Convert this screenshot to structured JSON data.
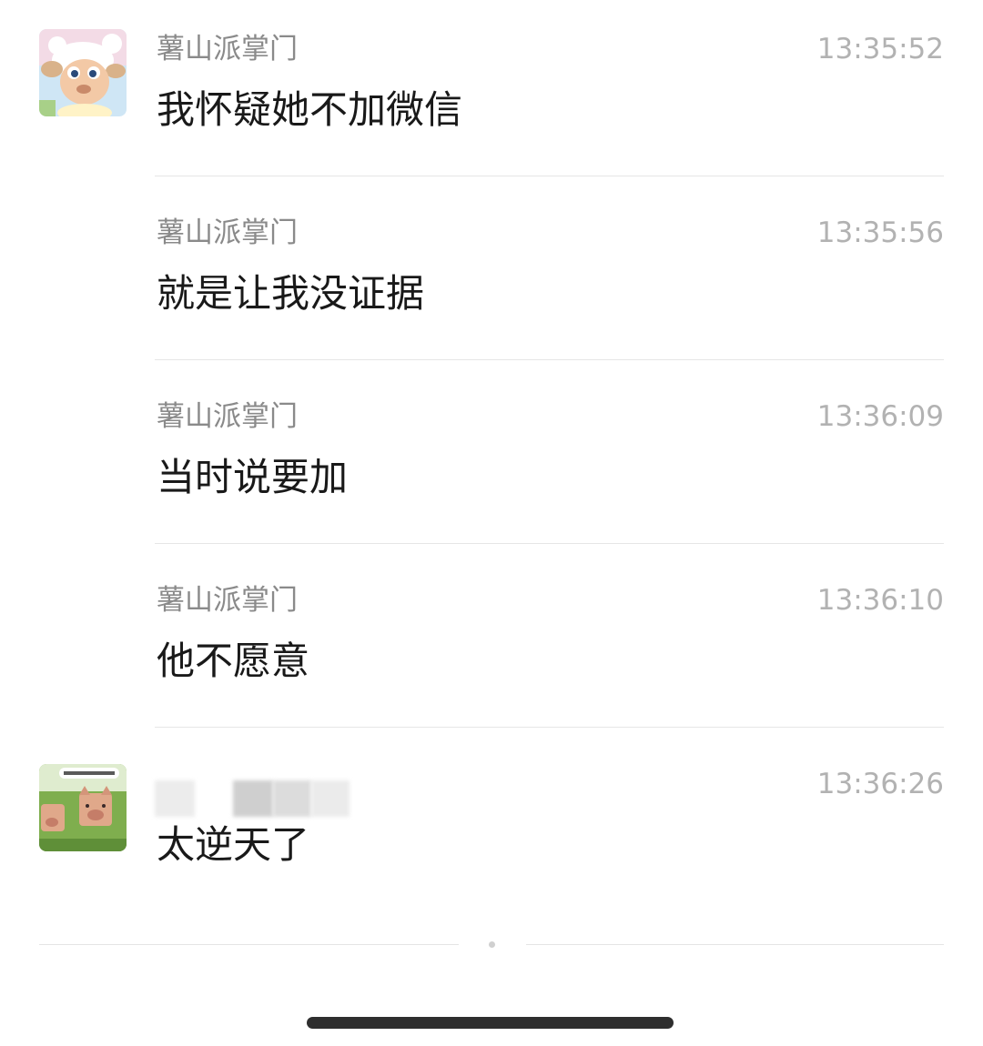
{
  "messages": [
    {
      "sender": "薯山派掌门",
      "time": "13:35:52",
      "text": "我怀疑她不加微信",
      "avatar": "sheep-avatar"
    },
    {
      "sender": "薯山派掌门",
      "time": "13:35:56",
      "text": "就是让我没证据"
    },
    {
      "sender": "薯山派掌门",
      "time": "13:36:09",
      "text": "当时说要加"
    },
    {
      "sender": "薯山派掌门",
      "time": "13:36:10",
      "text": "他不愿意"
    },
    {
      "sender": "",
      "time": "13:36:26",
      "text": "太逆天了",
      "avatar": "pig-avatar"
    }
  ],
  "colors": {
    "sender_text": "#8a8a8a",
    "time_text": "#b2b2b2",
    "message_text": "#191919",
    "divider": "#e6e6e6",
    "home_indicator": "#2e2e2e"
  }
}
